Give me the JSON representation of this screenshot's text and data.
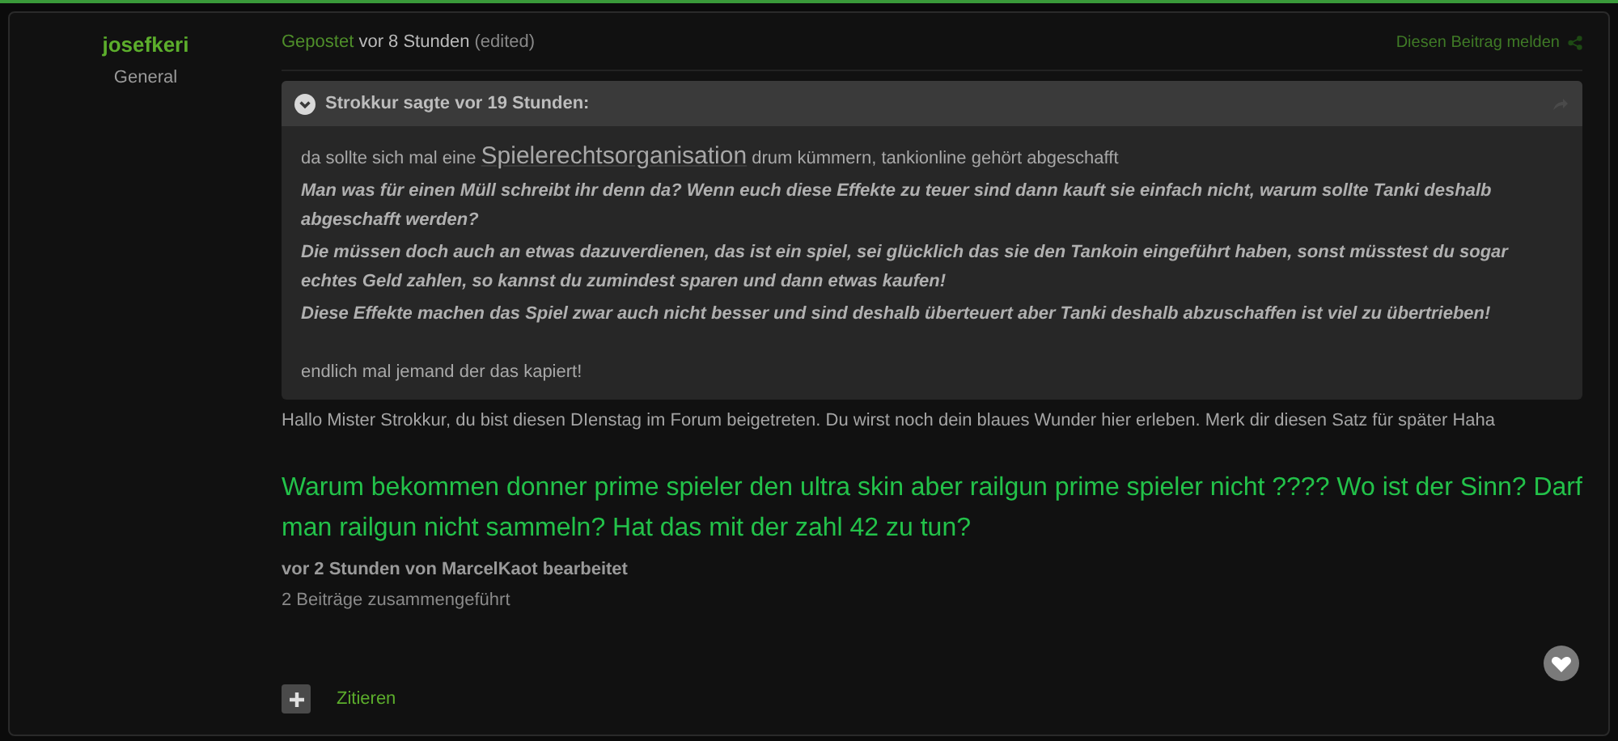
{
  "author": {
    "name": "josefkeri",
    "rank": "General"
  },
  "post_meta": {
    "prefix": "Gepostet",
    "time": "vor 8 Stunden",
    "edited": "(edited)",
    "report": "Diesen Beitrag melden"
  },
  "quote": {
    "header": "Strokkur sagte vor 19 Stunden:",
    "expanded": true,
    "paragraphs": [
      {
        "kind": "plain",
        "segments": [
          {
            "text": "da sollte sich mal eine ",
            "large": false
          },
          {
            "text": "Spielerechtsorganisation",
            "large": true
          },
          {
            "text": " drum kümmern, tankionline gehört abgeschafft",
            "large": false
          }
        ]
      },
      {
        "kind": "emphasis",
        "segments": [
          {
            "text": "Man was für einen Müll schreibt ihr denn da? Wenn euch diese Effekte zu teuer sind dann kauft sie einfach nicht, warum sollte Tanki deshalb abgeschafft werden?",
            "large": false
          }
        ]
      },
      {
        "kind": "emphasis",
        "segments": [
          {
            "text": "Die müssen doch auch an etwas dazuverdienen, das ist ein spiel, sei glücklich das sie den Tankoin eingeführt haben, sonst müsstest du sogar echtes Geld zahlen, so kannst du zumindest sparen und dann etwas kaufen!",
            "large": false
          }
        ]
      },
      {
        "kind": "emphasis",
        "segments": [
          {
            "text": "Diese Effekte machen das Spiel zwar auch nicht besser und sind deshalb überteuert aber Tanki deshalb abzuschaffen ist viel zu übertrieben!",
            "large": false
          }
        ]
      },
      {
        "kind": "gap"
      },
      {
        "kind": "plain",
        "segments": [
          {
            "text": "endlich mal jemand der das kapiert!",
            "large": false
          }
        ]
      }
    ]
  },
  "reply": "Hallo Mister Strokkur, du bist diesen DIenstag im Forum beigetreten. Du wirst noch dein blaues Wunder hier erleben. Merk dir diesen Satz für später Haha",
  "question": "Warum bekommen donner prime spieler den ultra skin aber railgun prime spieler nicht ???? Wo ist der Sinn? Darf man railgun nicht sammeln? Hat das mit der zahl 42 zu tun?",
  "edit_note": "**vor 2 Stunden** von MarcelKaot bearbeitet",
  "merge_note": "2 Beiträge zusammengeführt",
  "actions": {
    "quote": "Zitieren"
  }
}
